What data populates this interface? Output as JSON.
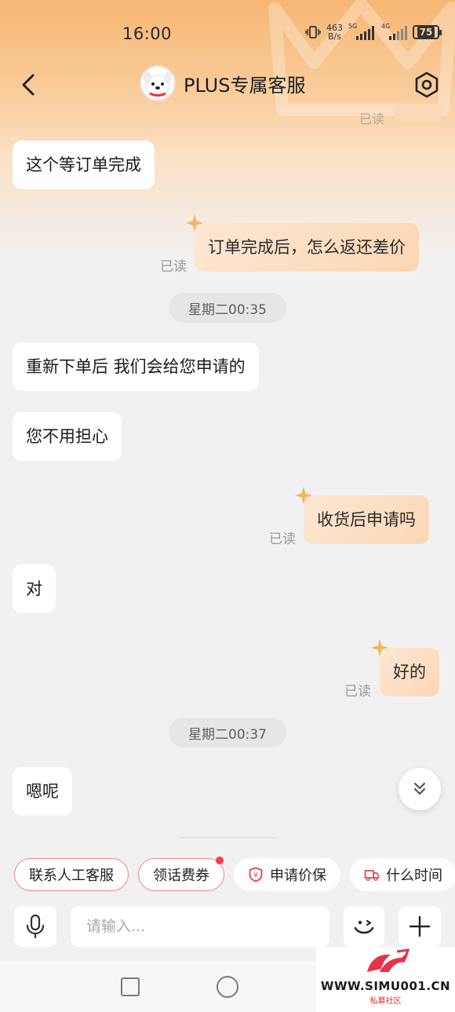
{
  "status_bar": {
    "time": "16:00",
    "net_speed_value": "463",
    "net_speed_unit": "B/s",
    "sim1_label": "5G",
    "sim2_label": "4G",
    "battery": "75"
  },
  "header": {
    "title": "PLUS专属客服"
  },
  "partial_read_label": "已读",
  "messages": [
    {
      "text": "这个等订单完成"
    },
    {
      "text": "订单完成后，怎么返还差价",
      "read": "已读"
    },
    {
      "timestamp": "星期二00:35"
    },
    {
      "text": "重新下单后 我们会给您申请的"
    },
    {
      "text": "您不用担心"
    },
    {
      "text": "收货后申请吗",
      "read": "已读"
    },
    {
      "text": "对"
    },
    {
      "text": "好的",
      "read": "已读"
    },
    {
      "timestamp": "星期二00:37"
    },
    {
      "text": "嗯呢"
    }
  ],
  "quick_actions": [
    {
      "label": "联系人工客服"
    },
    {
      "label": "领话费券"
    },
    {
      "label": "申请价保",
      "icon": "price-protect-icon"
    },
    {
      "label": "什么时间",
      "icon": "delivery-truck-icon"
    }
  ],
  "input": {
    "placeholder": "请输入..."
  },
  "watermark": {
    "site": "WWW.SIMU001.CN",
    "sub": "私募社区"
  },
  "colors": {
    "accent": "#f7b774",
    "outgoing_bubble": "#fbd6b2",
    "chip_border": "#f08a80",
    "badge": "#f2424a"
  }
}
